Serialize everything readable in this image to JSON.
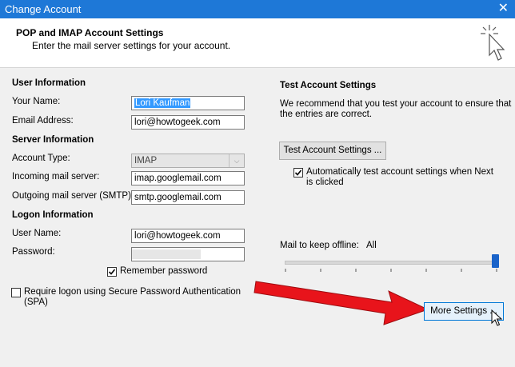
{
  "window": {
    "title": "Change Account",
    "close_glyph": "✕"
  },
  "header": {
    "title": "POP and IMAP Account Settings",
    "subtitle": "Enter the mail server settings for your account."
  },
  "user_info": {
    "section": "User Information",
    "name_label": "Your Name:",
    "name_value": "Lori Kaufman",
    "email_label": "Email Address:",
    "email_value": "lori@howtogeek.com"
  },
  "server_info": {
    "section": "Server Information",
    "account_type_label": "Account Type:",
    "account_type_value": "IMAP",
    "incoming_label": "Incoming mail server:",
    "incoming_value": "imap.googlemail.com",
    "outgoing_label": "Outgoing mail server (SMTP):",
    "outgoing_value": "smtp.googlemail.com"
  },
  "logon_info": {
    "section": "Logon Information",
    "username_label": "User Name:",
    "username_value": "lori@howtogeek.com",
    "password_label": "Password:",
    "remember_label": "Remember password",
    "spa_label_line1": "Require logon using Secure Password Authentication",
    "spa_label_line2": "(SPA)"
  },
  "test_settings": {
    "section": "Test Account Settings",
    "description_line1": "We recommend that you test your account to ensure that",
    "description_line2": "the entries are correct.",
    "button_label": "Test Account Settings ...",
    "auto_test_line1": "Automatically test account settings when Next",
    "auto_test_line2": "is clicked"
  },
  "offline": {
    "label": "Mail to keep offline:",
    "value": "All",
    "slider_fraction": 1.0
  },
  "more_settings": {
    "label": "More Settings ..."
  },
  "colors": {
    "titlebar": "#1e78d7",
    "selection": "#3399ff",
    "arrow": "#e8141b",
    "slider_thumb": "#1a63c9"
  },
  "icons": {
    "header_icon": "cursor-click-icon",
    "dropdown": "chevron-down-icon"
  }
}
